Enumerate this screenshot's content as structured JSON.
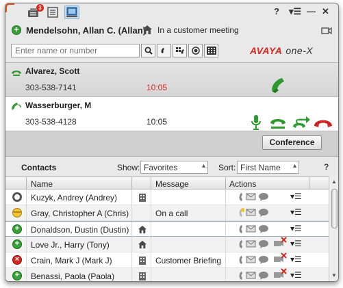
{
  "titlebar": {
    "missed_calls_count": "3",
    "controls": {
      "help": "?",
      "menu": "▾☰",
      "minimize": "—",
      "close": "✕"
    }
  },
  "user": {
    "name": "Mendelsohn, Allan C. (Allan)",
    "location_text": "In a customer meeting"
  },
  "search": {
    "placeholder": "Enter name or number"
  },
  "brand": {
    "part1": "AVAYA",
    "part2": "one-X"
  },
  "calls": [
    {
      "name": "Alvarez, Scott",
      "number": "303-538-7141",
      "time": "10:05",
      "state": "held"
    },
    {
      "name": "Wasserburger, M",
      "number": "303-538-4128",
      "time": "10:05",
      "state": "active"
    }
  ],
  "conference_label": "Conference",
  "contacts": {
    "title": "Contacts",
    "show_label": "Show:",
    "show_value": "Favorites",
    "sort_label": "Sort:",
    "sort_value": "First Name",
    "help": "?",
    "columns": {
      "name": "Name",
      "message": "Message",
      "actions": "Actions"
    },
    "rows": [
      {
        "name": "Kuzyk, Andrey (Andrey)",
        "status": "offline",
        "type": "building-icon",
        "message": ""
      },
      {
        "name": "Gray, Christopher A (Chris)",
        "status": "away",
        "type": "",
        "message": "On a call"
      },
      {
        "name": "Donaldson, Dustin (Dustin)",
        "status": "available",
        "type": "house-icon",
        "message": ""
      },
      {
        "name": "Love Jr., Harry (Tony)",
        "status": "available",
        "type": "house-icon",
        "message": ""
      },
      {
        "name": "Crain, Mark J (Mark J)",
        "status": "busy",
        "type": "building-icon",
        "message": "Customer Briefing"
      },
      {
        "name": "Benassi, Paola (Paola)",
        "status": "available",
        "type": "building-icon",
        "message": ""
      }
    ]
  },
  "colors": {
    "accent_orange": "#e4551d",
    "avaya_red": "#d8261d",
    "call_green": "#2e9a2e",
    "hangup_red": "#cc2222"
  }
}
